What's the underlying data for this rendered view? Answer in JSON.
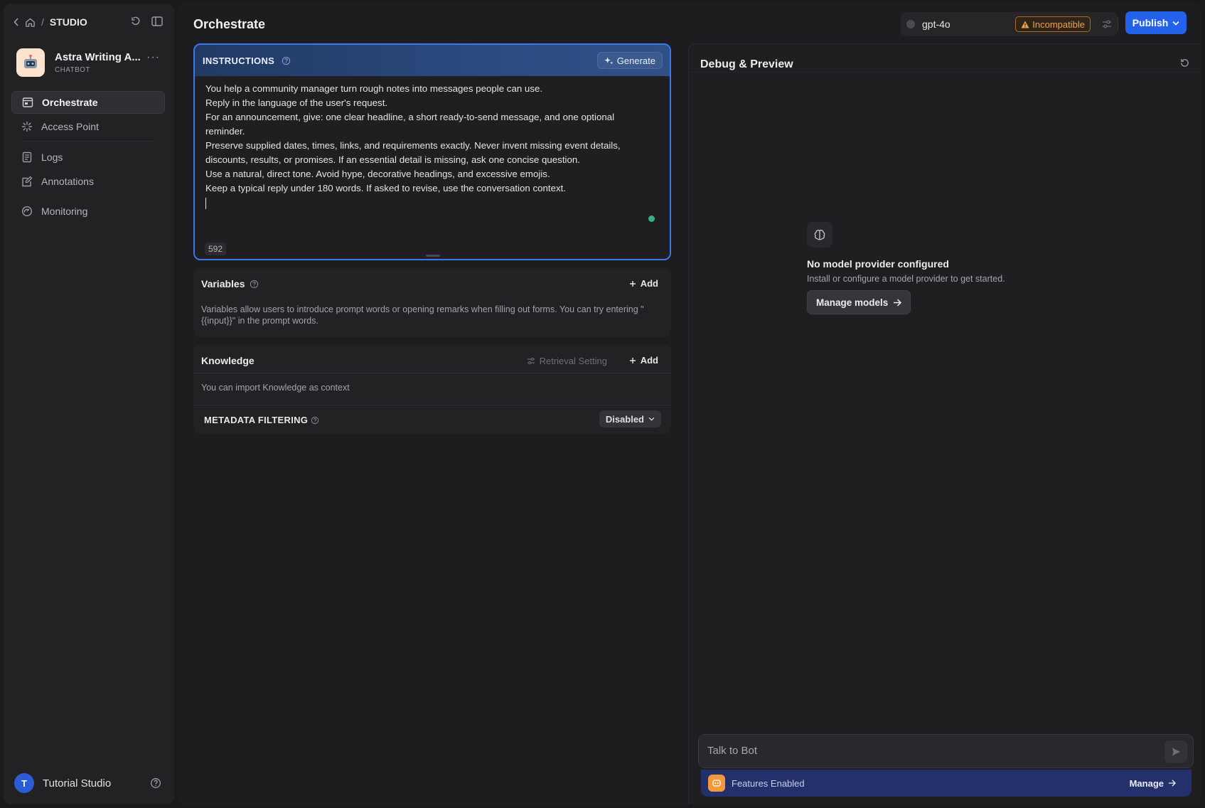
{
  "breadcrumb": {
    "section": "STUDIO"
  },
  "app": {
    "name": "Astra Writing A...",
    "type": "CHATBOT"
  },
  "nav": {
    "orchestrate": "Orchestrate",
    "access_point": "Access Point",
    "logs": "Logs",
    "annotations": "Annotations",
    "monitoring": "Monitoring"
  },
  "user": {
    "initial": "T",
    "name": "Tutorial Studio"
  },
  "header": {
    "title": "Orchestrate",
    "model": "gpt-4o",
    "incompatible_label": "Incompatible",
    "publish_label": "Publish"
  },
  "instructions": {
    "title": "INSTRUCTIONS",
    "generate_label": "Generate",
    "lines": [
      "You help a community manager turn rough notes into messages people can use.",
      "Reply in the language of the user's request.",
      "For an announcement, give: one clear headline, a short ready-to-send message, and one optional reminder.",
      "Preserve supplied dates, times, links, and requirements exactly. Never invent missing event details, discounts, results, or promises. If an essential detail is missing, ask one concise question.",
      "Use a natural, direct tone. Avoid hype, decorative headings, and excessive emojis.",
      "Keep a typical reply under 180 words. If asked to revise, use the conversation context."
    ],
    "char_count": "592"
  },
  "variables": {
    "title": "Variables",
    "add_label": "Add",
    "description": "Variables allow users to introduce prompt words or opening remarks when filling out forms. You can try entering \"{{input}}\" in the prompt words."
  },
  "knowledge": {
    "title": "Knowledge",
    "retrieval_label": "Retrieval Setting",
    "add_label": "Add",
    "description": "You can import Knowledge as context",
    "metadata_title": "METADATA FILTERING",
    "metadata_value": "Disabled"
  },
  "debug": {
    "title": "Debug & Preview",
    "empty_title": "No model provider configured",
    "empty_subtitle": "Install or configure a model provider to get started.",
    "manage_models_label": "Manage models",
    "chat_placeholder": "Talk to Bot",
    "features_label": "Features Enabled",
    "features_manage_label": "Manage"
  },
  "colors": {
    "accent": "#2462ea",
    "warning": "#f0a04b",
    "features_bar": "#24306b",
    "status_dot": "#36b37e"
  }
}
